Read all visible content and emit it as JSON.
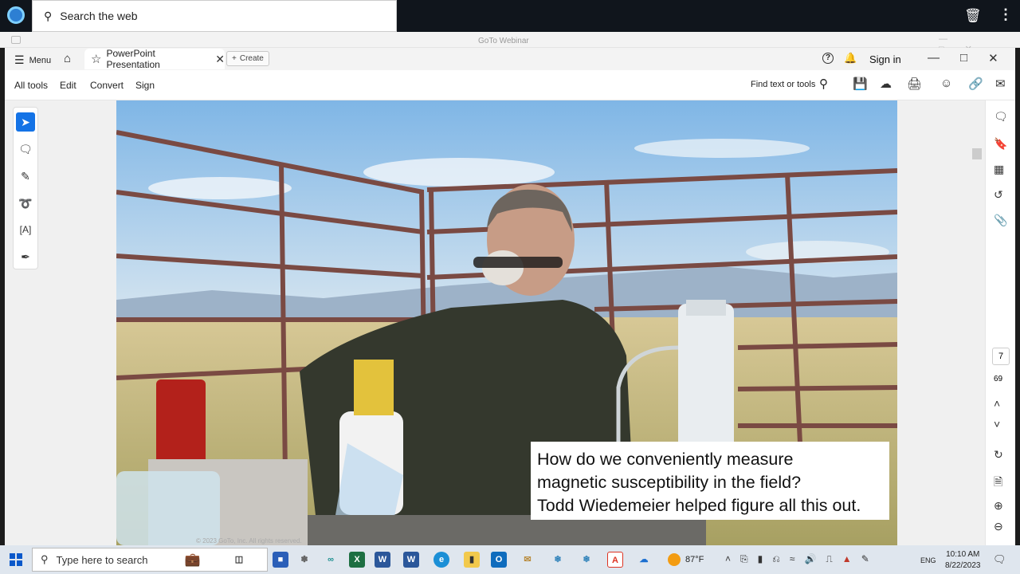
{
  "browser": {
    "search_placeholder": "Search the web"
  },
  "goto_window": {
    "title": "GoTo Webinar"
  },
  "acrobat": {
    "menu_label": "Menu",
    "tab_title": "PowerPoint Presentation",
    "create_label": "Create",
    "sign_in": "Sign in",
    "tools": [
      "All tools",
      "Edit",
      "Convert",
      "Sign"
    ],
    "find_label": "Find text or tools",
    "current_page": "7",
    "total_pages": "69"
  },
  "slide": {
    "caption_lines": [
      "How do we conveniently measure",
      "magnetic susceptibility in the field?",
      "Todd Wiedemeier helped figure all this out."
    ],
    "copyright": "© 2023 GoTo, Inc. All rights reserved."
  },
  "taskbar": {
    "search_placeholder": "Type here to search",
    "temperature": "87°F",
    "language": "ENG",
    "time": "10:10 AM",
    "date": "8/22/2023"
  },
  "colors": {
    "accent": "#1473e6",
    "sky": "#a9d0ef",
    "grass": "#c9b77a"
  }
}
